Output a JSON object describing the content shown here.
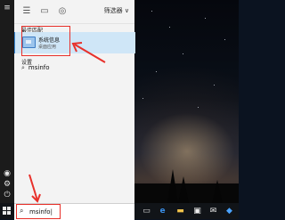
{
  "start_menu": {
    "filter_label": "筛选器",
    "best_match": {
      "section_title": "最佳匹配",
      "app_name": "系统信息",
      "app_type": "桌面应用"
    },
    "settings": {
      "section_title": "设置",
      "item_label": "msinfo"
    }
  },
  "search": {
    "query": "msinfo|"
  },
  "colors": {
    "accent": "#3a89d5",
    "highlight": "#cfe6f7",
    "annotation": "#e8302a"
  }
}
